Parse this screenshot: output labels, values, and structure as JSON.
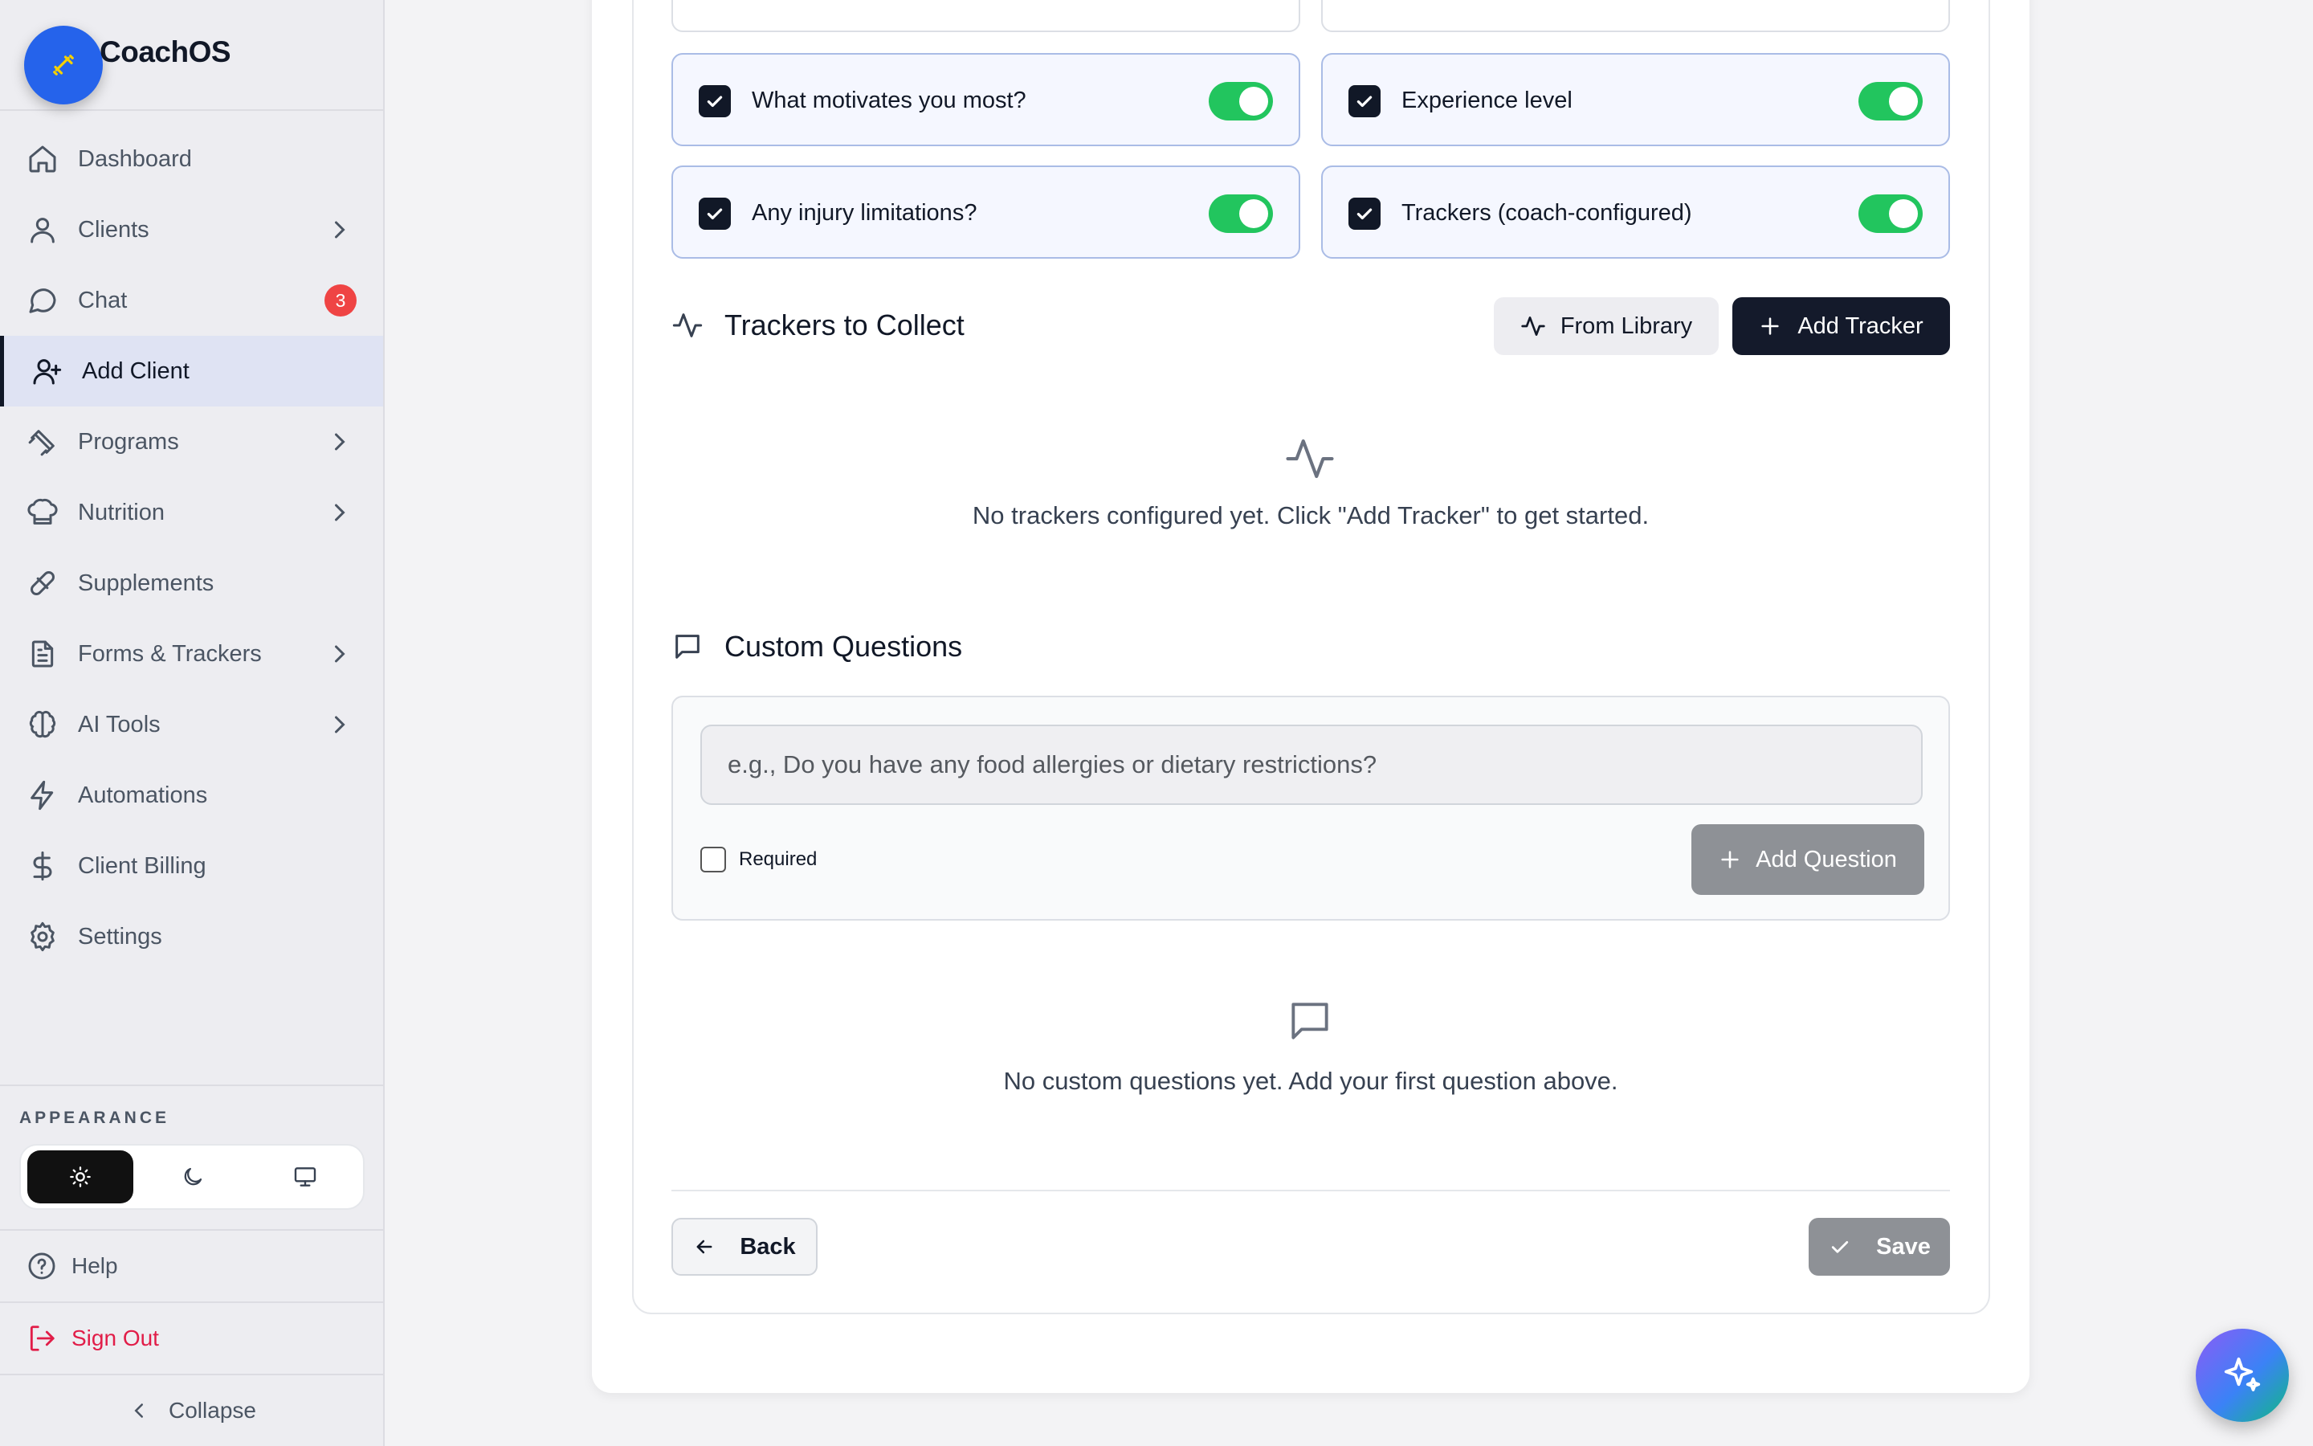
{
  "app": {
    "name": "CoachOS"
  },
  "sidebar": {
    "items": [
      {
        "label": "Dashboard"
      },
      {
        "label": "Clients"
      },
      {
        "label": "Chat",
        "badge": "3"
      },
      {
        "label": "Add Client"
      },
      {
        "label": "Programs"
      },
      {
        "label": "Nutrition"
      },
      {
        "label": "Supplements"
      },
      {
        "label": "Forms & Trackers"
      },
      {
        "label": "AI Tools"
      },
      {
        "label": "Automations"
      },
      {
        "label": "Client Billing"
      },
      {
        "label": "Settings"
      }
    ],
    "appearance_label": "APPEARANCE",
    "theme_selected": "light",
    "help_label": "Help",
    "signout_label": "Sign Out",
    "collapse_label": "Collapse"
  },
  "options": [
    {
      "label": "What motivates you most?",
      "checked": true,
      "enabled": true
    },
    {
      "label": "Experience level",
      "checked": true,
      "enabled": true
    },
    {
      "label": "Any injury limitations?",
      "checked": true,
      "enabled": true
    },
    {
      "label": "Trackers (coach-configured)",
      "checked": true,
      "enabled": true
    }
  ],
  "trackers": {
    "title": "Trackers to Collect",
    "from_library_label": "From Library",
    "add_tracker_label": "Add Tracker",
    "empty_text": "No trackers configured yet. Click \"Add Tracker\" to get started."
  },
  "custom_questions": {
    "title": "Custom Questions",
    "placeholder": "e.g., Do you have any food allergies or dietary restrictions?",
    "required_label": "Required",
    "add_question_label": "Add Question",
    "empty_text": "No custom questions yet. Add your first question above."
  },
  "footer": {
    "back_label": "Back",
    "save_label": "Save"
  },
  "colors": {
    "accent": "#141a2b",
    "toggle_on": "#22c55e",
    "badge": "#ef4444",
    "signout": "#e11d48",
    "disabled_button": "#8e9196"
  }
}
